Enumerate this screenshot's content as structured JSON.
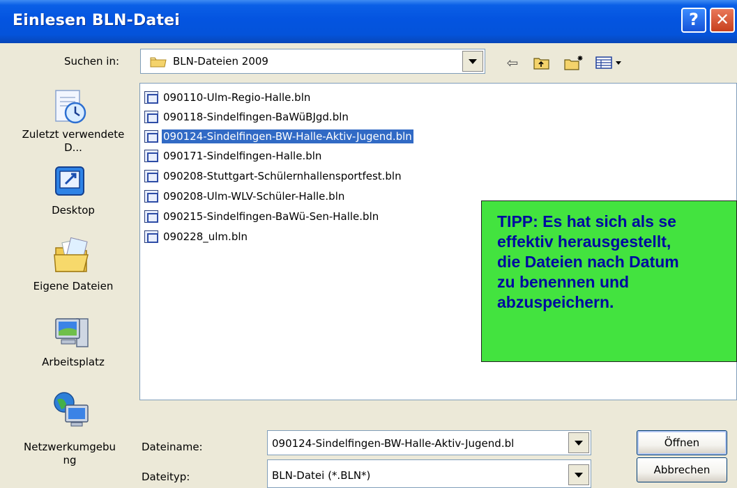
{
  "window": {
    "title": "Einlesen BLN-Datei",
    "help_glyph": "?",
    "close_glyph": "✕"
  },
  "lookin": {
    "label": "Suchen in:",
    "value": "BLN-Dateien 2009"
  },
  "toolbar": {
    "back_glyph": "⇦",
    "up_glyph": "⇧",
    "newfolder_glyph": "✱",
    "views_glyph": "▤"
  },
  "places": [
    {
      "label": "Zuletzt verwendete D...",
      "icon": "recent-documents-icon"
    },
    {
      "label": "Desktop",
      "icon": "desktop-icon"
    },
    {
      "label": "Eigene Dateien",
      "icon": "my-documents-icon"
    },
    {
      "label": "Arbeitsplatz",
      "icon": "my-computer-icon"
    },
    {
      "label": "Netzwerkumgebung",
      "icon": "network-places-icon"
    }
  ],
  "files": [
    {
      "name": "090110-Ulm-Regio-Halle.bln",
      "selected": false
    },
    {
      "name": "090118-Sindelfingen-BaWüBJgd.bln",
      "selected": false
    },
    {
      "name": "090124-Sindelfingen-BW-Halle-Aktiv-Jugend.bln",
      "selected": true
    },
    {
      "name": "090171-Sindelfingen-Halle.bln",
      "selected": false
    },
    {
      "name": "090208-Stuttgart-Schülernhallensportfest.bln",
      "selected": false
    },
    {
      "name": "090208-Ulm-WLV-Schüler-Halle.bln",
      "selected": false
    },
    {
      "name": "090215-Sindelfingen-BaWü-Sen-Halle.bln",
      "selected": false
    },
    {
      "name": "090228_ulm.bln",
      "selected": false
    }
  ],
  "tip": {
    "lines": [
      "TIPP: Es hat sich als se",
      "effektiv herausgestellt,",
      "die Dateien nach Datum",
      "zu benennen und",
      "abzuspeichern."
    ],
    "background": "#43e33f",
    "text_color": "#0009a0"
  },
  "filename": {
    "label": "Dateiname:",
    "value": "090124-Sindelfingen-BW-Halle-Aktiv-Jugend.bl"
  },
  "filetype": {
    "label": "Dateityp:",
    "value": "BLN-Datei (*.BLN*)"
  },
  "buttons": {
    "open": "Öffnen",
    "cancel": "Abbrechen"
  },
  "colors": {
    "titlebar": "#0454e0",
    "selection": "#316ac5",
    "dialog_bg": "#ece9d8"
  }
}
